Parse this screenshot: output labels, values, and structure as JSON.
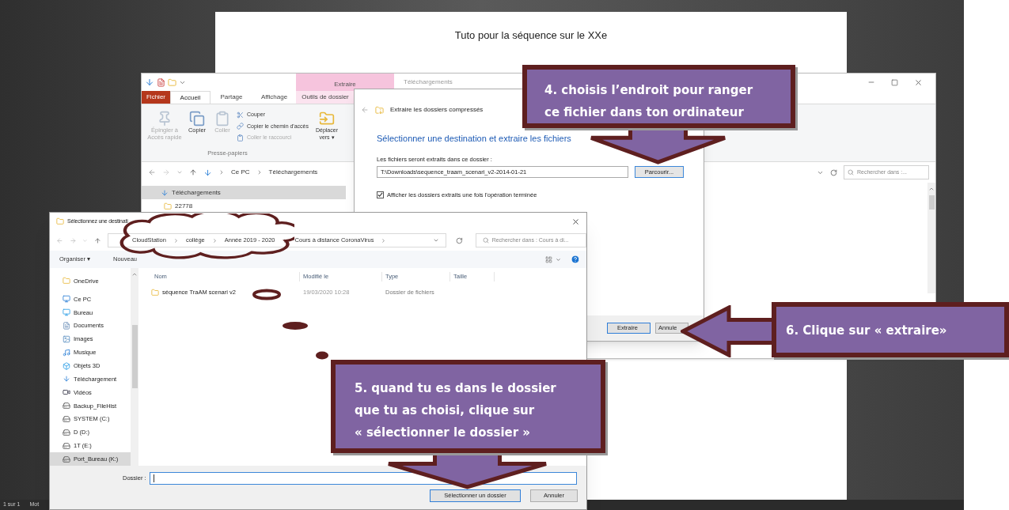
{
  "document": {
    "title": "Tuto pour la séquence sur le XXe"
  },
  "explorer": {
    "contextual_tab": "Extraire",
    "title": "Téléchargements",
    "tabs": [
      {
        "label": "Fichier",
        "selected": false,
        "kind": "file"
      },
      {
        "label": "Accueil",
        "selected": true,
        "kind": "tab"
      },
      {
        "label": "Partage",
        "selected": false,
        "kind": "tab"
      },
      {
        "label": "Affichage",
        "selected": false,
        "kind": "tab"
      },
      {
        "label": "Outils de dossier",
        "selected": false,
        "kind": "context"
      }
    ],
    "large_commands": [
      {
        "label": "Épingler à Accès rapide",
        "disabled": true,
        "kind": "pin"
      },
      {
        "label": "Copier",
        "disabled": false,
        "kind": "copy"
      },
      {
        "label": "Coller",
        "disabled": true,
        "kind": "paste"
      }
    ],
    "small_commands": [
      {
        "label": "Couper",
        "disabled": false,
        "kind": "cut"
      },
      {
        "label": "Copier le chemin d'accès",
        "disabled": false,
        "kind": "path"
      },
      {
        "label": "Coller le raccourci",
        "disabled": true,
        "kind": "shortcut"
      }
    ],
    "group_label": "Presse-papiers",
    "move_command": "Déplacer vers ▾",
    "breadcrumb": [
      "Ce PC",
      "Téléchargements"
    ],
    "search": {
      "placeholder": "Rechercher dans :..."
    },
    "tree": [
      {
        "label": "Téléchargements",
        "selected": true,
        "kind": "download"
      },
      {
        "label": "22778",
        "selected": false,
        "kind": "folder"
      }
    ]
  },
  "extract_dialog": {
    "title": "Extraire les dossiers compressés",
    "heading": "Sélectionner une destination et extraire les fichiers",
    "field_label": "Les fichiers seront extraits dans ce dossier :",
    "path": "T:\\Downloads\\sequence_traam_scenari_v2-2014-01-21",
    "browse": "Parcourir...",
    "show_option": {
      "label": "Afficher les dossiers extraits une fois l'opération terminée",
      "checked": true
    },
    "buttons": [
      {
        "label": "Extraire",
        "focused": true
      },
      {
        "label": "Annule",
        "focused": false
      }
    ]
  },
  "folder_dialog": {
    "title": "Sélectionnez une destinati",
    "path": [
      "CloudStation",
      "collège",
      "Année 2019 - 2020",
      "Cours à distance CoronaVirus"
    ],
    "search": {
      "placeholder": "Rechercher dans : Cours à di..."
    },
    "toolbar": [
      "Organiser ▾",
      "Nouveau"
    ],
    "sidebar": [
      {
        "label": "OneDrive",
        "kind": "folder",
        "selected": false
      },
      {
        "label": "Ce PC",
        "kind": "pc",
        "selected": false
      },
      {
        "label": "Bureau",
        "kind": "desktop",
        "selected": false
      },
      {
        "label": "Documents",
        "kind": "docs",
        "selected": false
      },
      {
        "label": "Images",
        "kind": "images",
        "selected": false
      },
      {
        "label": "Musique",
        "kind": "music",
        "selected": false
      },
      {
        "label": "Objets 3D",
        "kind": "cube",
        "selected": false
      },
      {
        "label": "Téléchargement",
        "kind": "download",
        "selected": false
      },
      {
        "label": "Vidéos",
        "kind": "video",
        "selected": false
      },
      {
        "label": "Backup_FileHist",
        "kind": "drive",
        "selected": false
      },
      {
        "label": "SYSTEM (C:)",
        "kind": "drive",
        "selected": false
      },
      {
        "label": "D (D:)",
        "kind": "drive",
        "selected": false
      },
      {
        "label": "1T (E:)",
        "kind": "drive",
        "selected": false
      },
      {
        "label": "Port_Bureau (K:)",
        "kind": "drive",
        "selected": true
      }
    ],
    "columns": [
      "Nom",
      "Modifié le",
      "Type",
      "Taille"
    ],
    "rows": [
      {
        "name": "séquence TraAM scenari v2",
        "modified": "19/03/2020 10:28",
        "type": "Dossier de fichiers"
      }
    ],
    "folder_label": "Dossier :",
    "buttons": [
      {
        "label": "Sélectionner un dossier",
        "focused": true
      },
      {
        "label": "Annuler",
        "focused": false
      }
    ]
  },
  "callouts": [
    {
      "lines": [
        "4. choisis l’endroit pour ranger",
        "ce fichier dans ton ordinateur"
      ],
      "kind": "down"
    },
    {
      "lines": [
        "6. Clique sur « extraire»"
      ],
      "kind": "left"
    },
    {
      "lines": [
        "5. quand tu es dans le dossier",
        "que tu as choisi, clique sur",
        "« sélectionner le dossier »"
      ],
      "kind": "down"
    }
  ],
  "status_bar": {
    "page": "1 sur 1",
    "words": "Mot"
  }
}
